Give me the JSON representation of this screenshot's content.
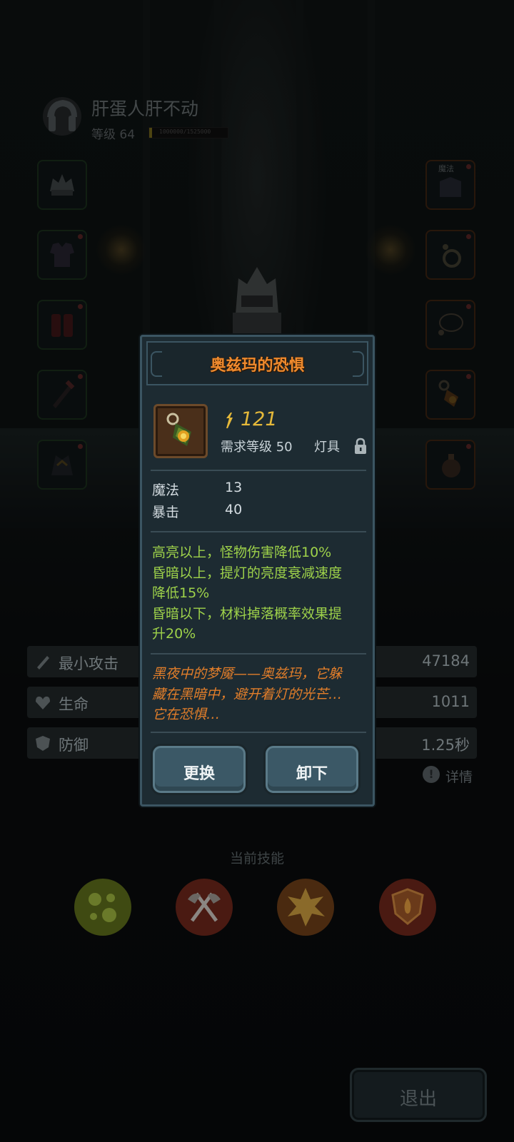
{
  "profile": {
    "name": "肝蛋人肝不动",
    "level": "等级 64",
    "xp_text": "1000000/1525000",
    "xp_progress": 0.04
  },
  "equipment": {
    "right_top_tag": "魔法"
  },
  "stats": [
    {
      "label": "最小攻击",
      "value": "47184"
    },
    {
      "label": "生命",
      "value": "1011"
    },
    {
      "label": "防御",
      "value": "1.25秒"
    }
  ],
  "detail_link": "详情",
  "skills_title": "当前技能",
  "exit_button": "退出",
  "item_popup": {
    "title": "奥兹玛的恐惧",
    "power": "121",
    "required_level": "需求等级 50",
    "slot_type": "灯具",
    "attributes": [
      {
        "name": "魔法",
        "value": "13"
      },
      {
        "name": "暴击",
        "value": "40"
      }
    ],
    "effect_lines": [
      "高亮以上，怪物伤害降低10%",
      "昏暗以上，提灯的亮度衰减速度",
      "降低15%",
      "昏暗以下，材料掉落概率效果提",
      "升20%"
    ],
    "lore_lines": [
      "黑夜中的梦魇——奥兹玛，它躲",
      "藏在黑暗中，避开着灯的光芒…",
      "它在恐惧…"
    ],
    "replace_button": "更换",
    "unequip_button": "卸下"
  },
  "colors": {
    "title_orange": "#ee8a2e",
    "power_gold": "#e5b93a",
    "effect_green": "#9ed24a",
    "lore_orange": "#e27e2a"
  }
}
